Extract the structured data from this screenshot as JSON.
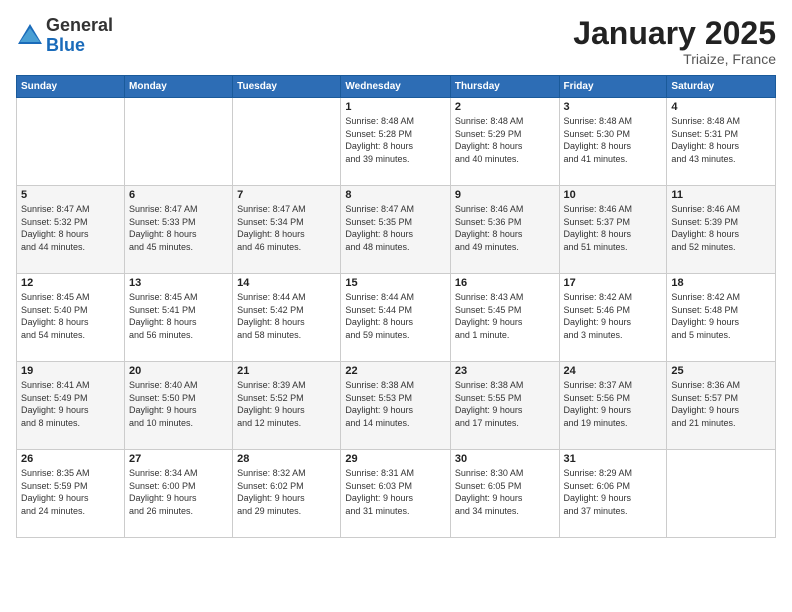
{
  "logo": {
    "general": "General",
    "blue": "Blue"
  },
  "title": "January 2025",
  "location": "Triaize, France",
  "weekdays": [
    "Sunday",
    "Monday",
    "Tuesday",
    "Wednesday",
    "Thursday",
    "Friday",
    "Saturday"
  ],
  "weeks": [
    [
      {
        "day": "",
        "info": ""
      },
      {
        "day": "",
        "info": ""
      },
      {
        "day": "",
        "info": ""
      },
      {
        "day": "1",
        "info": "Sunrise: 8:48 AM\nSunset: 5:28 PM\nDaylight: 8 hours\nand 39 minutes."
      },
      {
        "day": "2",
        "info": "Sunrise: 8:48 AM\nSunset: 5:29 PM\nDaylight: 8 hours\nand 40 minutes."
      },
      {
        "day": "3",
        "info": "Sunrise: 8:48 AM\nSunset: 5:30 PM\nDaylight: 8 hours\nand 41 minutes."
      },
      {
        "day": "4",
        "info": "Sunrise: 8:48 AM\nSunset: 5:31 PM\nDaylight: 8 hours\nand 43 minutes."
      }
    ],
    [
      {
        "day": "5",
        "info": "Sunrise: 8:47 AM\nSunset: 5:32 PM\nDaylight: 8 hours\nand 44 minutes."
      },
      {
        "day": "6",
        "info": "Sunrise: 8:47 AM\nSunset: 5:33 PM\nDaylight: 8 hours\nand 45 minutes."
      },
      {
        "day": "7",
        "info": "Sunrise: 8:47 AM\nSunset: 5:34 PM\nDaylight: 8 hours\nand 46 minutes."
      },
      {
        "day": "8",
        "info": "Sunrise: 8:47 AM\nSunset: 5:35 PM\nDaylight: 8 hours\nand 48 minutes."
      },
      {
        "day": "9",
        "info": "Sunrise: 8:46 AM\nSunset: 5:36 PM\nDaylight: 8 hours\nand 49 minutes."
      },
      {
        "day": "10",
        "info": "Sunrise: 8:46 AM\nSunset: 5:37 PM\nDaylight: 8 hours\nand 51 minutes."
      },
      {
        "day": "11",
        "info": "Sunrise: 8:46 AM\nSunset: 5:39 PM\nDaylight: 8 hours\nand 52 minutes."
      }
    ],
    [
      {
        "day": "12",
        "info": "Sunrise: 8:45 AM\nSunset: 5:40 PM\nDaylight: 8 hours\nand 54 minutes."
      },
      {
        "day": "13",
        "info": "Sunrise: 8:45 AM\nSunset: 5:41 PM\nDaylight: 8 hours\nand 56 minutes."
      },
      {
        "day": "14",
        "info": "Sunrise: 8:44 AM\nSunset: 5:42 PM\nDaylight: 8 hours\nand 58 minutes."
      },
      {
        "day": "15",
        "info": "Sunrise: 8:44 AM\nSunset: 5:44 PM\nDaylight: 8 hours\nand 59 minutes."
      },
      {
        "day": "16",
        "info": "Sunrise: 8:43 AM\nSunset: 5:45 PM\nDaylight: 9 hours\nand 1 minute."
      },
      {
        "day": "17",
        "info": "Sunrise: 8:42 AM\nSunset: 5:46 PM\nDaylight: 9 hours\nand 3 minutes."
      },
      {
        "day": "18",
        "info": "Sunrise: 8:42 AM\nSunset: 5:48 PM\nDaylight: 9 hours\nand 5 minutes."
      }
    ],
    [
      {
        "day": "19",
        "info": "Sunrise: 8:41 AM\nSunset: 5:49 PM\nDaylight: 9 hours\nand 8 minutes."
      },
      {
        "day": "20",
        "info": "Sunrise: 8:40 AM\nSunset: 5:50 PM\nDaylight: 9 hours\nand 10 minutes."
      },
      {
        "day": "21",
        "info": "Sunrise: 8:39 AM\nSunset: 5:52 PM\nDaylight: 9 hours\nand 12 minutes."
      },
      {
        "day": "22",
        "info": "Sunrise: 8:38 AM\nSunset: 5:53 PM\nDaylight: 9 hours\nand 14 minutes."
      },
      {
        "day": "23",
        "info": "Sunrise: 8:38 AM\nSunset: 5:55 PM\nDaylight: 9 hours\nand 17 minutes."
      },
      {
        "day": "24",
        "info": "Sunrise: 8:37 AM\nSunset: 5:56 PM\nDaylight: 9 hours\nand 19 minutes."
      },
      {
        "day": "25",
        "info": "Sunrise: 8:36 AM\nSunset: 5:57 PM\nDaylight: 9 hours\nand 21 minutes."
      }
    ],
    [
      {
        "day": "26",
        "info": "Sunrise: 8:35 AM\nSunset: 5:59 PM\nDaylight: 9 hours\nand 24 minutes."
      },
      {
        "day": "27",
        "info": "Sunrise: 8:34 AM\nSunset: 6:00 PM\nDaylight: 9 hours\nand 26 minutes."
      },
      {
        "day": "28",
        "info": "Sunrise: 8:32 AM\nSunset: 6:02 PM\nDaylight: 9 hours\nand 29 minutes."
      },
      {
        "day": "29",
        "info": "Sunrise: 8:31 AM\nSunset: 6:03 PM\nDaylight: 9 hours\nand 31 minutes."
      },
      {
        "day": "30",
        "info": "Sunrise: 8:30 AM\nSunset: 6:05 PM\nDaylight: 9 hours\nand 34 minutes."
      },
      {
        "day": "31",
        "info": "Sunrise: 8:29 AM\nSunset: 6:06 PM\nDaylight: 9 hours\nand 37 minutes."
      },
      {
        "day": "",
        "info": ""
      }
    ]
  ]
}
